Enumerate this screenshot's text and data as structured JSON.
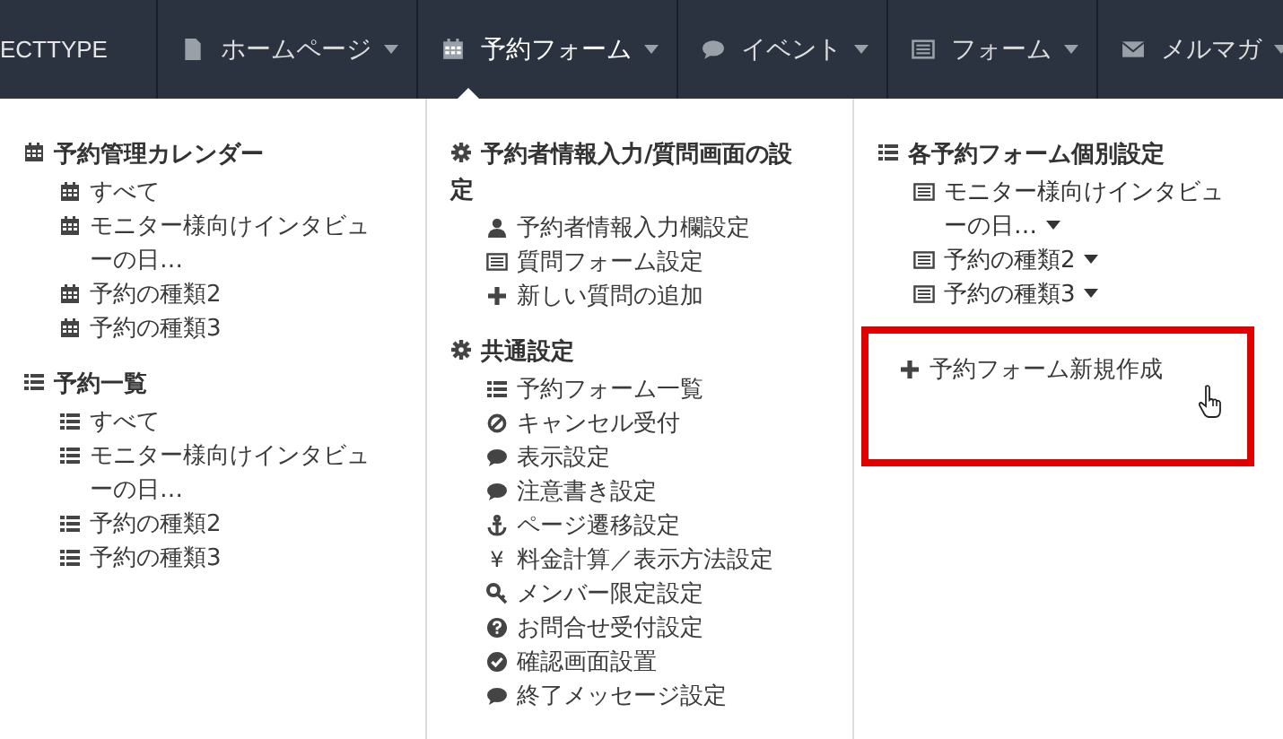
{
  "navbar": {
    "brand": "ECTTYPE",
    "items": [
      {
        "label": "ホームページ",
        "selected": false
      },
      {
        "label": "予約フォーム",
        "selected": true
      },
      {
        "label": "イベント",
        "selected": false
      },
      {
        "label": "フォーム",
        "selected": false
      },
      {
        "label": "メルマガ",
        "selected": false
      }
    ]
  },
  "dropdown": {
    "columns": [
      {
        "sections": [
          {
            "heading": "予約管理カレンダー",
            "items": [
              {
                "label": "すべて"
              },
              {
                "label": "モニター様向けインタビューの日…"
              },
              {
                "label": "予約の種類2"
              },
              {
                "label": "予約の種類3"
              }
            ]
          },
          {
            "heading": "予約一覧",
            "items": [
              {
                "label": "すべて"
              },
              {
                "label": "モニター様向けインタビューの日…"
              },
              {
                "label": "予約の種類2"
              },
              {
                "label": "予約の種類3"
              }
            ]
          }
        ]
      },
      {
        "sections": [
          {
            "heading": "予約者情報入力/質問画面の設定",
            "items": [
              {
                "label": "予約者情報入力欄設定"
              },
              {
                "label": "質問フォーム設定"
              },
              {
                "label": "新しい質問の追加"
              }
            ]
          },
          {
            "heading": "共通設定",
            "items": [
              {
                "label": "予約フォーム一覧"
              },
              {
                "label": "キャンセル受付"
              },
              {
                "label": "表示設定"
              },
              {
                "label": "注意書き設定"
              },
              {
                "label": "ページ遷移設定"
              },
              {
                "label": "料金計算／表示方法設定",
                "glyph": "¥"
              },
              {
                "label": "メンバー限定設定"
              },
              {
                "label": "お問合せ受付設定"
              },
              {
                "label": "確認画面設置"
              },
              {
                "label": "終了メッセージ設定"
              }
            ]
          }
        ]
      },
      {
        "sections": [
          {
            "heading": "各予約フォーム個別設定",
            "items": [
              {
                "label": "モニター様向けインタビューの日…",
                "has_menu": true
              },
              {
                "label": "予約の種類2",
                "has_menu": true
              },
              {
                "label": "予約の種類3",
                "has_menu": true
              },
              {
                "label": "予約フォーム新規作成",
                "has_menu": false,
                "highlighted": true
              }
            ]
          }
        ]
      }
    ]
  }
}
